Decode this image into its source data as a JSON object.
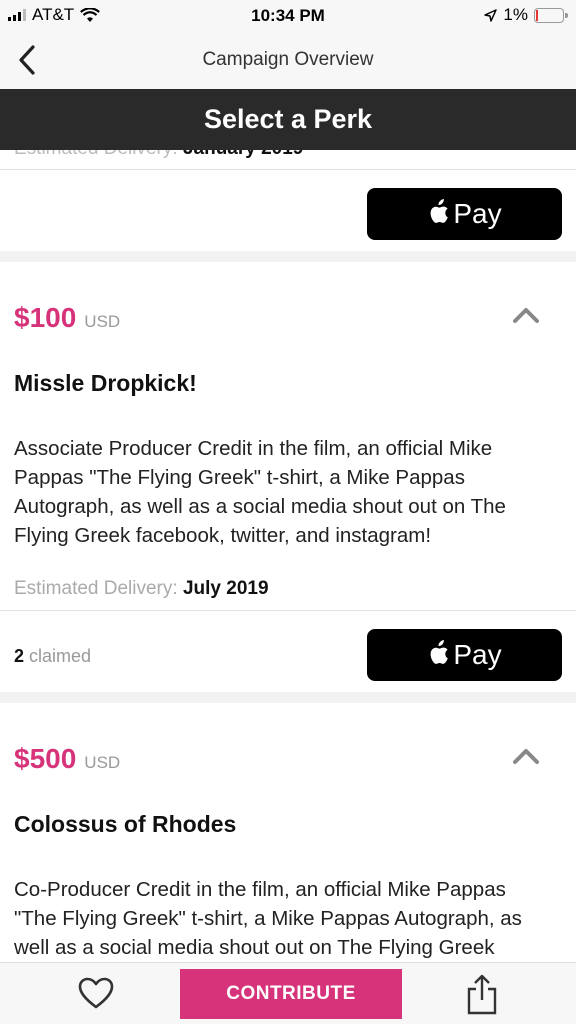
{
  "status_bar": {
    "carrier": "AT&T",
    "time": "10:34 PM",
    "battery": "1%"
  },
  "nav": {
    "title": "Campaign Overview"
  },
  "header": {
    "title": "Select a Perk"
  },
  "partial_card": {
    "delivery_label": "Estimated Delivery:",
    "delivery_value": "January 2019",
    "pay_label": "Pay"
  },
  "perks": [
    {
      "price": "$100",
      "currency": "USD",
      "title": "Missle Dropkick!",
      "description": "Associate Producer Credit in the film, an official Mike Pappas \"The Flying Greek\" t-shirt, a Mike Pappas Autograph, as well as a social media shout out on The Flying Greek facebook, twitter, and instagram!",
      "delivery_label": "Estimated Delivery:",
      "delivery_value": "July 2019",
      "claimed_count": "2",
      "claimed_label": "claimed",
      "pay_label": "Pay"
    },
    {
      "price": "$500",
      "currency": "USD",
      "title": "Colossus of Rhodes",
      "description": "Co-Producer Credit in the film, an official Mike Pappas \"The Flying Greek\" t-shirt, a Mike Pappas Autograph, as well as a social media shout out on The Flying Greek"
    }
  ],
  "tab_bar": {
    "contribute_label": "CONTRIBUTE"
  },
  "colors": {
    "accent": "#d6337a",
    "header_bg": "#2a2a2a"
  }
}
